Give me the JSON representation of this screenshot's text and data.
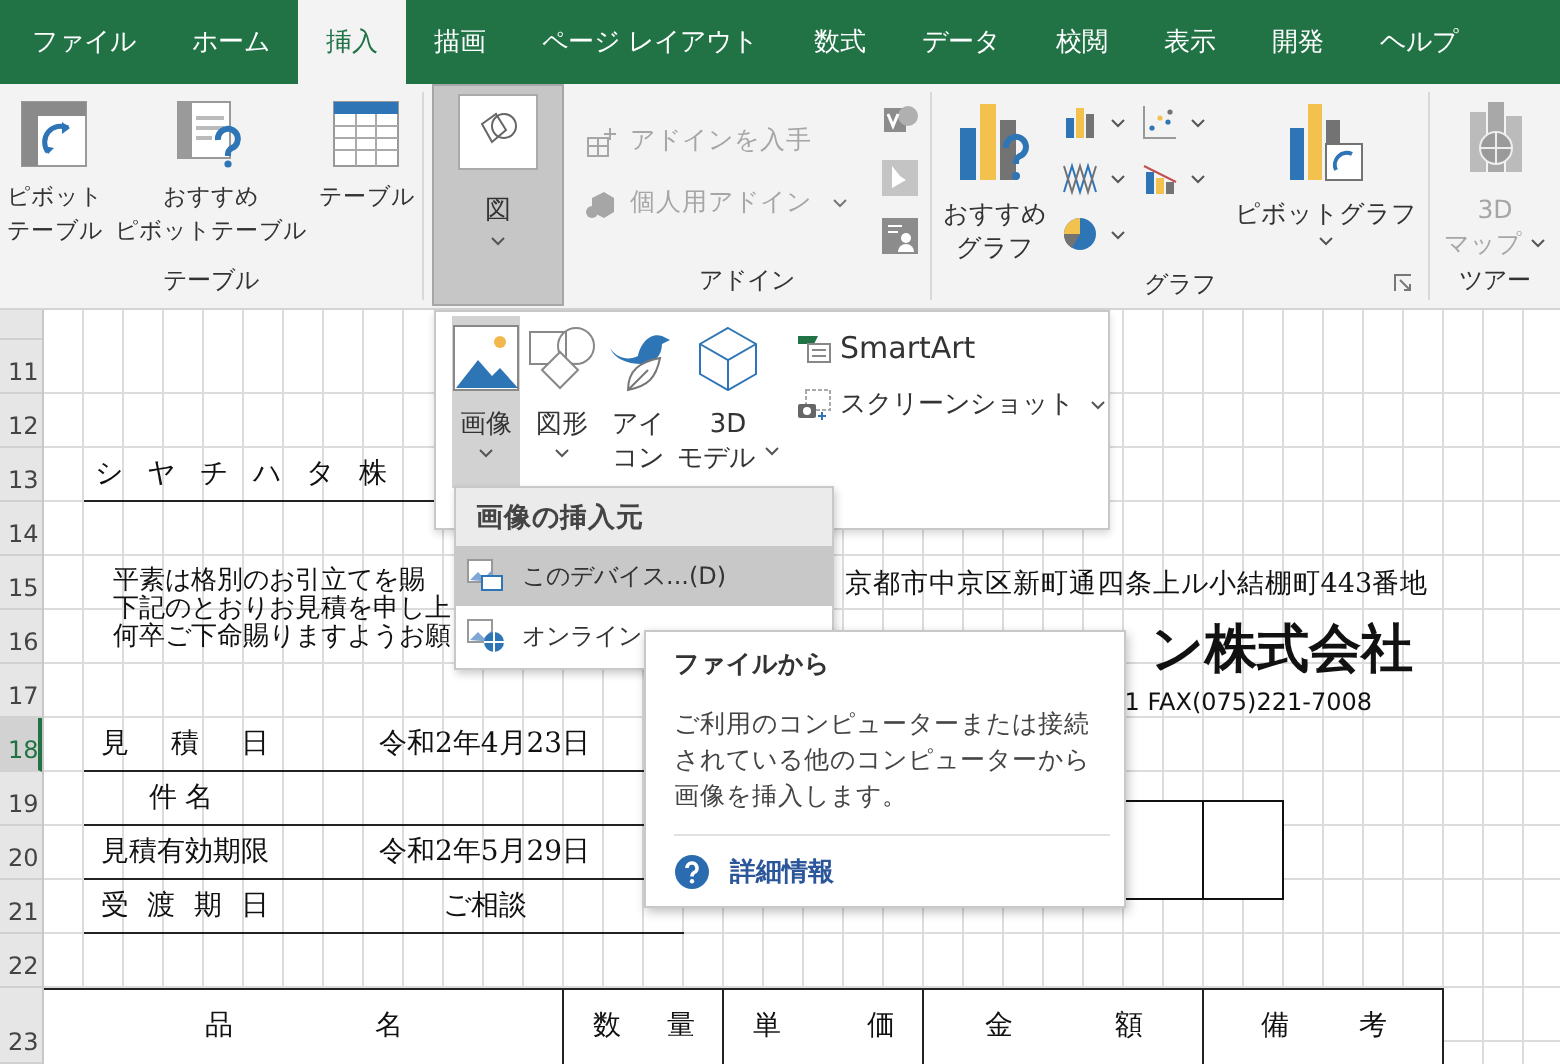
{
  "tabs": [
    {
      "label": "ファイル",
      "selected": false
    },
    {
      "label": "ホーム",
      "selected": false
    },
    {
      "label": "挿入",
      "selected": true
    },
    {
      "label": "描画",
      "selected": false
    },
    {
      "label": "ページ レイアウト",
      "selected": false
    },
    {
      "label": "数式",
      "selected": false
    },
    {
      "label": "データ",
      "selected": false
    },
    {
      "label": "校閲",
      "selected": false
    },
    {
      "label": "表示",
      "selected": false
    },
    {
      "label": "開発",
      "selected": false
    },
    {
      "label": "ヘルプ",
      "selected": false
    }
  ],
  "ribbon": {
    "groups": [
      {
        "kind": "tables",
        "label": "テーブル",
        "buttons": [
          {
            "lines": [
              "ピボット",
              "テーブル"
            ]
          },
          {
            "lines": [
              "おすすめ",
              "ピボットテーブル"
            ]
          },
          {
            "lines": [
              "テーブル"
            ]
          }
        ]
      },
      {
        "kind": "illustrations",
        "button": {
          "lines": [
            "図"
          ],
          "selected": true
        }
      },
      {
        "kind": "addins",
        "label": "アドイン",
        "items": [
          {
            "label": "アドインを入手",
            "disabled": true
          },
          {
            "label": "個人用アドイン",
            "disabled": true
          }
        ]
      },
      {
        "kind": "charts",
        "label": "グラフ",
        "recommended": {
          "lines": [
            "おすすめ",
            "グラフ"
          ]
        },
        "pivot": {
          "lines": [
            "ピボットグラフ"
          ]
        }
      },
      {
        "kind": "tours",
        "label": "ツアー",
        "button": {
          "lines": [
            "3D",
            "マップ"
          ],
          "disabled": true
        }
      }
    ]
  },
  "illustrations_menu": {
    "items": [
      {
        "kind": "large",
        "lines": [
          "画像"
        ],
        "selected": true,
        "has_menu": true
      },
      {
        "kind": "large",
        "lines": [
          "図形"
        ],
        "selected": false,
        "has_menu": true
      },
      {
        "kind": "large",
        "lines": [
          "アイ",
          "コン"
        ],
        "selected": false,
        "has_menu": false
      },
      {
        "kind": "large",
        "lines": [
          "3D",
          "モデル"
        ],
        "selected": false,
        "has_menu": true
      },
      {
        "kind": "small",
        "label": "SmartArt",
        "selected": false,
        "has_menu": false
      },
      {
        "kind": "small",
        "label": "スクリーンショット",
        "selected": false,
        "has_menu": true
      }
    ]
  },
  "picture_menu": {
    "header": "画像の挿入元",
    "items": [
      {
        "label": "このデバイス...(D)",
        "selected": true
      },
      {
        "label": "オンライン",
        "selected": false
      }
    ]
  },
  "tooltip": {
    "title": "ファイルから",
    "body": "ご利用のコンピューターまたは接続されている他のコンピューターから画像を挿入します。",
    "link": "詳細情報"
  },
  "sheet": {
    "rows": [
      {
        "number": "11",
        "selected": false
      },
      {
        "number": "12",
        "selected": false
      },
      {
        "number": "13",
        "selected": false
      },
      {
        "number": "14",
        "selected": false
      },
      {
        "number": "15",
        "selected": false
      },
      {
        "number": "16",
        "selected": false
      },
      {
        "number": "17",
        "selected": false
      },
      {
        "number": "18",
        "selected": true
      },
      {
        "number": "19",
        "selected": false
      },
      {
        "number": "20",
        "selected": false
      },
      {
        "number": "21",
        "selected": false
      },
      {
        "number": "22",
        "selected": false
      },
      {
        "number": "23",
        "selected": false
      }
    ]
  },
  "document": {
    "recipient": "シ ヤ チ ハ タ 株",
    "greeting": [
      "平素は格別のお引立てを賜",
      "下記のとおりお見積を申し上",
      "何卒ご下命賜りますようお願"
    ],
    "address": "京都市中京区新町通四条上ル小結棚町443番地",
    "company": "ン株式会社",
    "contact": "1 FAX(075)221-7008",
    "fields": [
      {
        "label": "見 積 日",
        "value": "令和2年4月23日"
      },
      {
        "label": "件 名"
      },
      {
        "label": "見積有効期限",
        "value": "令和2年5月29日"
      },
      {
        "label": "受 渡 期 日",
        "value": "ご相談"
      }
    ],
    "table_headers": [
      "品 名",
      "数 量",
      "単 価",
      "金 額",
      "備 考"
    ]
  }
}
